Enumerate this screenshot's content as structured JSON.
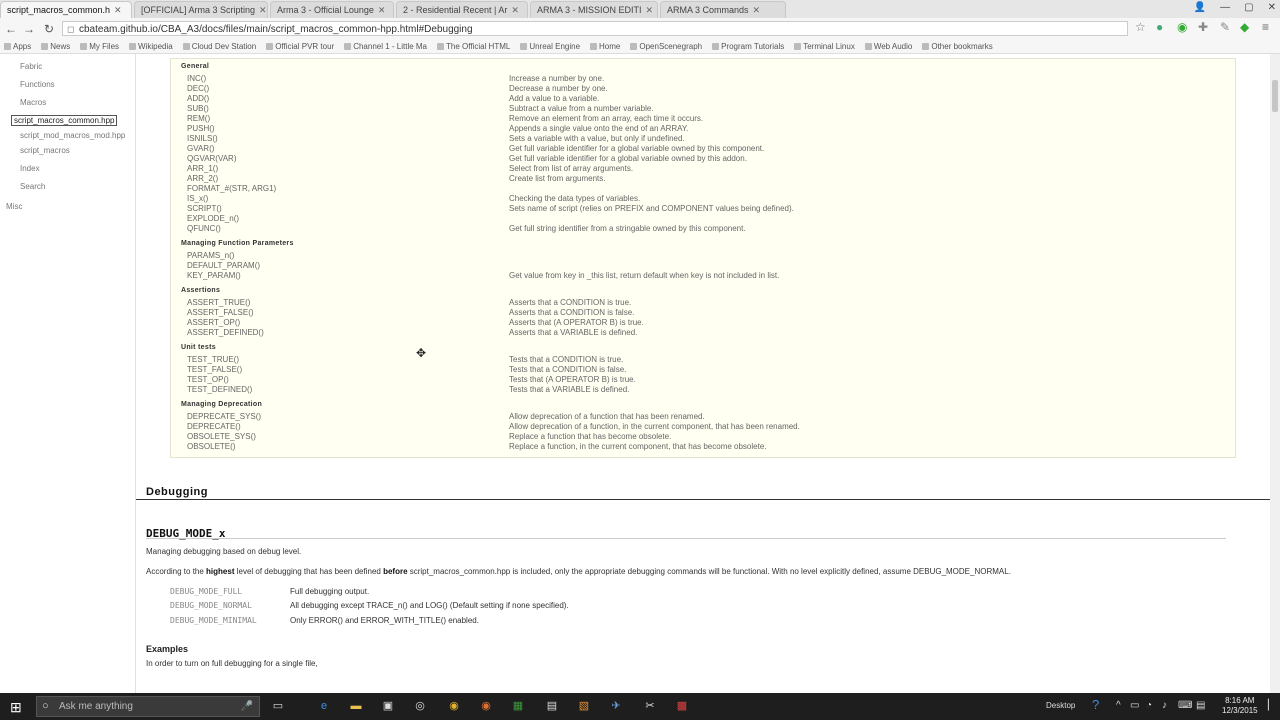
{
  "tabs": [
    {
      "label": "script_macros_common.h",
      "active": true
    },
    {
      "label": "[OFFICIAL] Arma 3 Scripting",
      "active": false
    },
    {
      "label": "Arma 3 - Official Lounge",
      "active": false
    },
    {
      "label": "2 - Residential Recent | Ar",
      "active": false
    },
    {
      "label": "ARMA 3 - MISSION EDITI",
      "active": false
    },
    {
      "label": "ARMA 3 Commands",
      "active": false
    }
  ],
  "url": "cbateam.github.io/CBA_A3/docs/files/main/script_macros_common-hpp.html#Debugging",
  "bookmarks": [
    "Apps",
    "News",
    "My Files",
    "Wikipedia",
    "Cloud Dev Station",
    "Official PVR tour",
    "Channel 1 - Little Ma",
    "The Official HTML",
    "Unreal Engine",
    "Home",
    "OpenScenegraph",
    "Program Tutorials",
    "Terminal Linux",
    "Web Audio",
    "Other bookmarks"
  ],
  "sidebar": {
    "items": [
      {
        "label": "Fabric"
      },
      {
        "label": "Functions"
      },
      {
        "label": "Macros"
      },
      {
        "label": "script_macros_common.hpp",
        "current": true
      },
      {
        "label": "script_mod_macros_mod.hpp"
      },
      {
        "label": "script_macros"
      },
      {
        "label": "Index"
      },
      {
        "label": "Search"
      },
      {
        "label": "Misc"
      }
    ]
  },
  "macros": {
    "rows": [
      {
        "type": "head",
        "name": "General"
      },
      {
        "name": "INC()",
        "desc": "Increase a number by one."
      },
      {
        "name": "DEC()",
        "desc": "Decrease a number by one."
      },
      {
        "name": "ADD()",
        "desc": "Add a value to a variable."
      },
      {
        "name": "SUB()",
        "desc": "Subtract a value from a number variable."
      },
      {
        "name": "REM()",
        "desc": "Remove an element from an array, each time it occurs."
      },
      {
        "name": "PUSH()",
        "desc": "Appends a single value onto the end of an ARRAY."
      },
      {
        "name": "ISNILS()",
        "desc": "Sets a variable with a value, but only if undefined."
      },
      {
        "name": "GVAR()",
        "desc": "Get full variable identifier for a global variable owned by this component."
      },
      {
        "name": "QGVAR(VAR)",
        "desc": "Get full variable identifier for a global variable owned by this addon."
      },
      {
        "name": "ARR_1()",
        "desc": "Select from list of array arguments."
      },
      {
        "name": "ARR_2()",
        "desc": "Create list from arguments."
      },
      {
        "name": "FORMAT_#(STR, ARG1)",
        "desc": ""
      },
      {
        "name": "IS_x()",
        "desc": "Checking the data types of variables."
      },
      {
        "name": "SCRIPT()",
        "desc": "Sets name of script (relies on PREFIX and COMPONENT values being defined)."
      },
      {
        "name": "EXPLODE_n()",
        "desc": ""
      },
      {
        "name": "QFUNC()",
        "desc": "Get full string identifier from a stringable owned by this component."
      },
      {
        "type": "head",
        "name": "Managing Function Parameters"
      },
      {
        "name": "PARAMS_n()",
        "desc": ""
      },
      {
        "name": "DEFAULT_PARAM()",
        "desc": ""
      },
      {
        "name": "KEY_PARAM()",
        "desc": "Get value from key in _this list, return default when key is not included in list."
      },
      {
        "type": "head",
        "name": "Assertions"
      },
      {
        "name": "ASSERT_TRUE()",
        "desc": "Asserts that a CONDITION is true."
      },
      {
        "name": "ASSERT_FALSE()",
        "desc": "Asserts that a CONDITION is false."
      },
      {
        "name": "ASSERT_OP()",
        "desc": "Asserts that (A OPERATOR B) is true."
      },
      {
        "name": "ASSERT_DEFINED()",
        "desc": "Asserts that a VARIABLE is defined."
      },
      {
        "type": "head",
        "name": "Unit tests"
      },
      {
        "name": "TEST_TRUE()",
        "desc": "Tests that a CONDITION is true."
      },
      {
        "name": "TEST_FALSE()",
        "desc": "Tests that a CONDITION is false."
      },
      {
        "name": "TEST_OP()",
        "desc": "Tests that (A OPERATOR B) is true."
      },
      {
        "name": "TEST_DEFINED()",
        "desc": "Tests that a VARIABLE is defined."
      },
      {
        "type": "head",
        "name": "Managing Deprecation"
      },
      {
        "name": "DEPRECATE_SYS()",
        "desc": "Allow deprecation of a function that has been renamed."
      },
      {
        "name": "DEPRECATE()",
        "desc": "Allow deprecation of a function, in the current component, that has been renamed."
      },
      {
        "name": "OBSOLETE_SYS()",
        "desc": "Replace a function that has become obsolete."
      },
      {
        "name": "OBSOLETE()",
        "desc": "Replace a function, in the current component, that has become obsolete."
      }
    ]
  },
  "debugging": {
    "heading": "Debugging",
    "subheading": "DEBUG_MODE_x",
    "summary": "Managing debugging based on debug level.",
    "para_prefix": "According to the ",
    "para_bold1": "highest",
    "para_mid": " level of debugging that has been defined ",
    "para_bold2": "before",
    "para_suffix": " script_macros_common.hpp is included, only the appropriate debugging commands will be functional.  With no level explicitly defined, assume DEBUG_MODE_NORMAL.",
    "levels": [
      {
        "name": "DEBUG_MODE_FULL",
        "desc": "Full debugging output."
      },
      {
        "name": "DEBUG_MODE_NORMAL",
        "desc": "All debugging except TRACE_n() and LOG() (Default setting if none specified)."
      },
      {
        "name": "DEBUG_MODE_MINIMAL",
        "desc": "Only ERROR() and ERROR_WITH_TITLE() enabled."
      }
    ],
    "examples_heading": "Examples",
    "examples_text": "In order to turn on full debugging for a single file,"
  },
  "taskbar": {
    "search_placeholder": "Ask me anything",
    "desktop_label": "Desktop",
    "time": "8:16 AM",
    "date": "12/3/2015"
  }
}
